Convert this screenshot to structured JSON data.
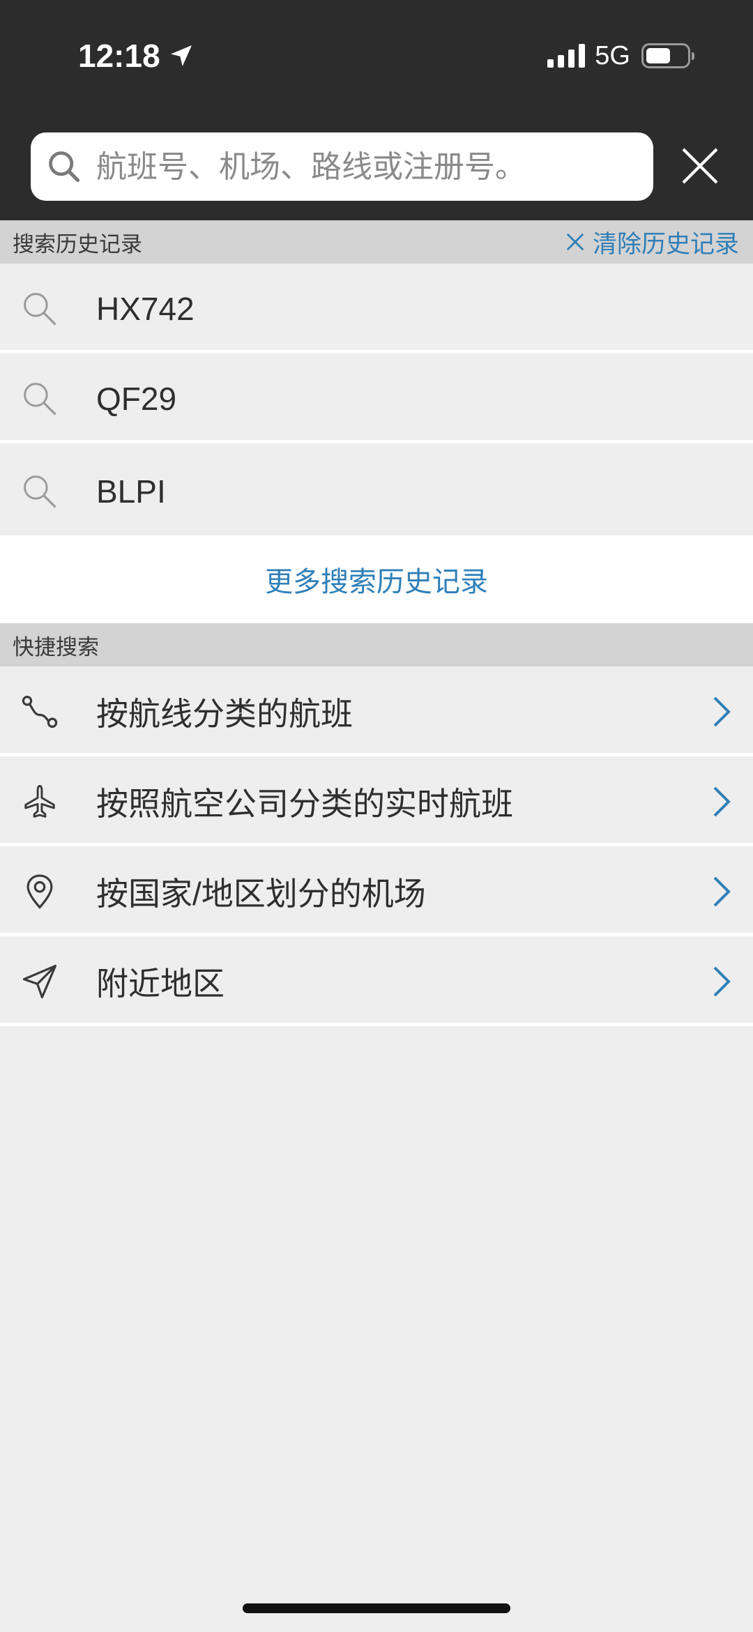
{
  "status_bar": {
    "time": "12:18",
    "network": "5G",
    "icons": [
      "location-arrow-icon",
      "signal-icon",
      "battery-icon"
    ]
  },
  "search": {
    "placeholder": "航班号、机场、路线或注册号。",
    "value": ""
  },
  "history": {
    "header": "搜索历史记录",
    "clear_label": "清除历史记录",
    "items": [
      {
        "label": "HX742",
        "icon": "search-icon"
      },
      {
        "label": "QF29",
        "icon": "search-icon"
      },
      {
        "label": "BLPI",
        "icon": "search-icon"
      }
    ],
    "more_label": "更多搜索历史记录"
  },
  "quick_search": {
    "header": "快捷搜索",
    "items": [
      {
        "label": "按航线分类的航班",
        "icon": "route-icon"
      },
      {
        "label": "按照航空公司分类的实时航班",
        "icon": "airplane-icon"
      },
      {
        "label": "按国家/地区划分的机场",
        "icon": "map-pin-icon"
      },
      {
        "label": "附近地区",
        "icon": "navigation-arrow-icon"
      }
    ]
  },
  "colors": {
    "topbar": "#2c2c2c",
    "accent": "#2f7fb8",
    "section_header": "#d3d3d3",
    "background": "#eeeeee"
  }
}
